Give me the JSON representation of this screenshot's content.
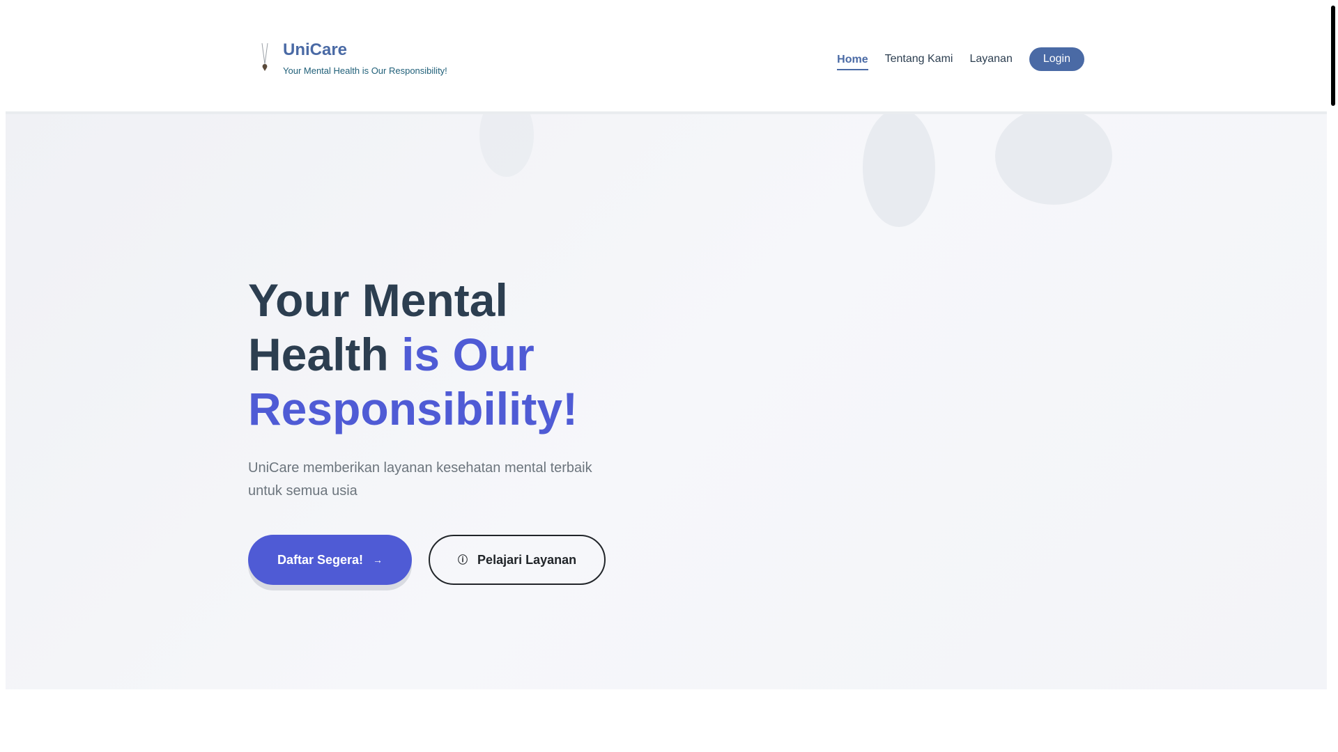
{
  "header": {
    "brand_name": "UniCare",
    "brand_tagline": "Your Mental Health is Our Responsibility!",
    "nav": [
      {
        "label": "Home",
        "active": true
      },
      {
        "label": "Tentang Kami",
        "active": false
      },
      {
        "label": "Layanan",
        "active": false
      }
    ],
    "login_label": "Login"
  },
  "hero": {
    "title_line1": "Your Mental",
    "title_line2_dark": "Health",
    "title_line2_accent": "is Our",
    "title_line3": "Responsibility!",
    "subtitle": "UniCare memberikan layanan kesehatan mental terbaik untuk semua usia",
    "primary_button_label": "Daftar Segera!",
    "primary_button_icon": "arrow-right-icon",
    "secondary_button_label": "Pelajari Layanan",
    "secondary_button_icon": "info-icon"
  },
  "colors": {
    "brand": "#4a6aa5",
    "accent": "#4f5bd5",
    "dark_text": "#2c3e50",
    "muted_text": "#6c757d"
  }
}
